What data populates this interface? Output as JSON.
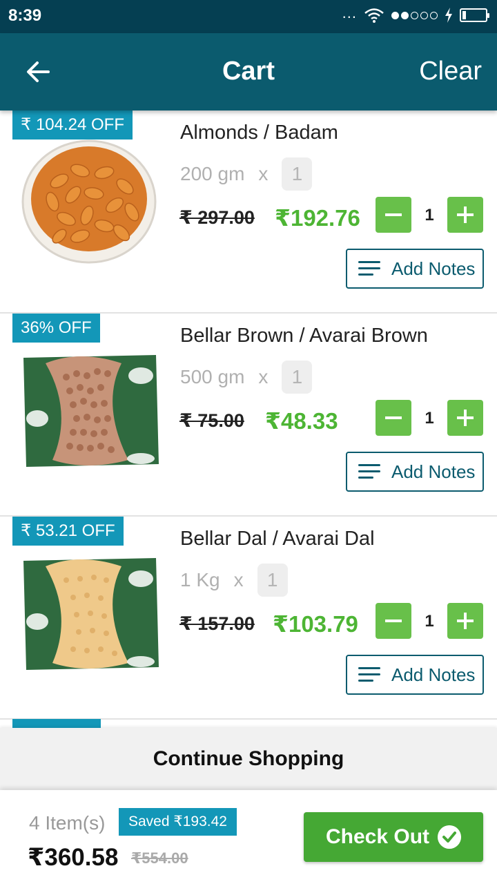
{
  "status": {
    "time": "8:39",
    "dots": "...",
    "battery_level": 0.12
  },
  "header": {
    "title": "Cart",
    "clear_label": "Clear"
  },
  "items": [
    {
      "badge": "₹ 104.24 OFF",
      "name": "Almonds / Badam",
      "unit": "200 gm",
      "times": "x",
      "qty": "1",
      "old_price": "₹ 297.00",
      "new_price": "₹192.76",
      "count": "1",
      "notes_label": "Add Notes",
      "image": "almonds"
    },
    {
      "badge": "36% OFF",
      "name": "Bellar Brown / Avarai Brown",
      "unit": "500 gm",
      "times": "x",
      "qty": "1",
      "old_price": "₹ 75.00",
      "new_price": "₹48.33",
      "count": "1",
      "notes_label": "Add Notes",
      "image": "brown-beans-pack"
    },
    {
      "badge": "₹ 53.21 OFF",
      "name": "Bellar Dal / Avarai Dal",
      "unit": "1 Kg",
      "times": "x",
      "qty": "1",
      "old_price": "₹ 157.00",
      "new_price": "₹103.79",
      "count": "1",
      "notes_label": "Add Notes",
      "image": "dal-pack"
    }
  ],
  "continue_label": "Continue Shopping",
  "footer": {
    "items_count": "4 Item(s)",
    "saved": "Saved ₹193.42",
    "total": "₹360.58",
    "original_total": "₹554.00",
    "checkout_label": "Check Out"
  },
  "colors": {
    "header": "#0b5b6e",
    "status_bar": "#053f52",
    "badge": "#1397b8",
    "price_green": "#4db534",
    "button_green": "#68c04a",
    "checkout_green": "#45a834"
  }
}
